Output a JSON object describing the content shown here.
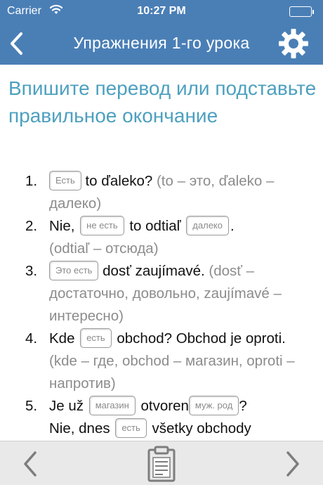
{
  "status_bar": {
    "carrier": "Carrier",
    "time": "10:27 PM",
    "battery_level": 1.0
  },
  "nav": {
    "title": "Упражнения 1-го урока",
    "back_icon": "chevron-left-icon",
    "settings_icon": "gear-icon"
  },
  "instruction": "Впишите перевод или подставьте правильное окончание",
  "items": [
    {
      "number": "1.",
      "blank1": "Есть",
      "text1": "to ďaleko?",
      "hint": "(to – это, ďaleko – далеко)"
    },
    {
      "number": "2.",
      "text1": "Nie,",
      "blank1": "не есть",
      "text2": "to odtiaľ",
      "blank2": "далеко",
      "text3": ".",
      "hint": "(odtiaľ – отсюда)"
    },
    {
      "number": "3.",
      "blank1": "Это есть",
      "text1": "dosť zaujímavé.",
      "hint": "(dosť – достаточно, довольно, zaujímavé – интересно)"
    },
    {
      "number": "4.",
      "text1": "Kde",
      "blank1": "есть",
      "text2": "obchod? Obchod je oproti.",
      "hint": "(kde – где, obchod – магазин, oproti – напротив)"
    },
    {
      "number": "5.",
      "text1": "Je už",
      "blank1": "магазин",
      "text2": "otvoren",
      "blank2": "муж. род",
      "text3": "?",
      "text4": "Nie, dnes",
      "blank3": "есть",
      "text5": "všetky obchody"
    }
  ],
  "toolbar": {
    "prev_icon": "chevron-left-icon",
    "notes_icon": "clipboard-icon",
    "next_icon": "chevron-right-icon"
  },
  "colors": {
    "nav_bar": "#4a7fb6",
    "instruction_text": "#4da0bf",
    "hint_text": "#8c8c8c",
    "toolbar_bg": "#e9e9e9",
    "toolbar_icon": "#7d7d7d"
  }
}
